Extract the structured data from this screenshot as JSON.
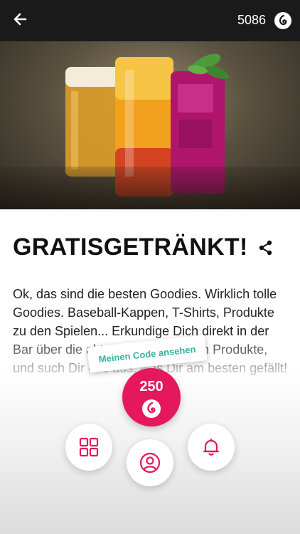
{
  "header": {
    "points": "5086"
  },
  "reward": {
    "title": "GRATISGETRÄNKT!",
    "description": "Ok, das sind die besten Goodies. Wirklich tolle Goodies. Baseball-Kappen, T-Shirts, Produkte zu den Spielen... Erkundige Dich direkt in der Bar über die aktuellen verfügbaren Produkte, und such Dir das aus, was Dir am besten gefällt!",
    "code_button_label": "Meinen Code ansehen",
    "price": "250"
  },
  "colors": {
    "accent": "#e6185d",
    "link": "#35b2a1",
    "topbar": "#1a1a1a"
  },
  "icons": {
    "back": "arrow-left-icon",
    "coin": "coin-icon",
    "share": "share-icon",
    "grid": "grid-icon",
    "profile": "profile-icon",
    "bell": "bell-icon"
  }
}
